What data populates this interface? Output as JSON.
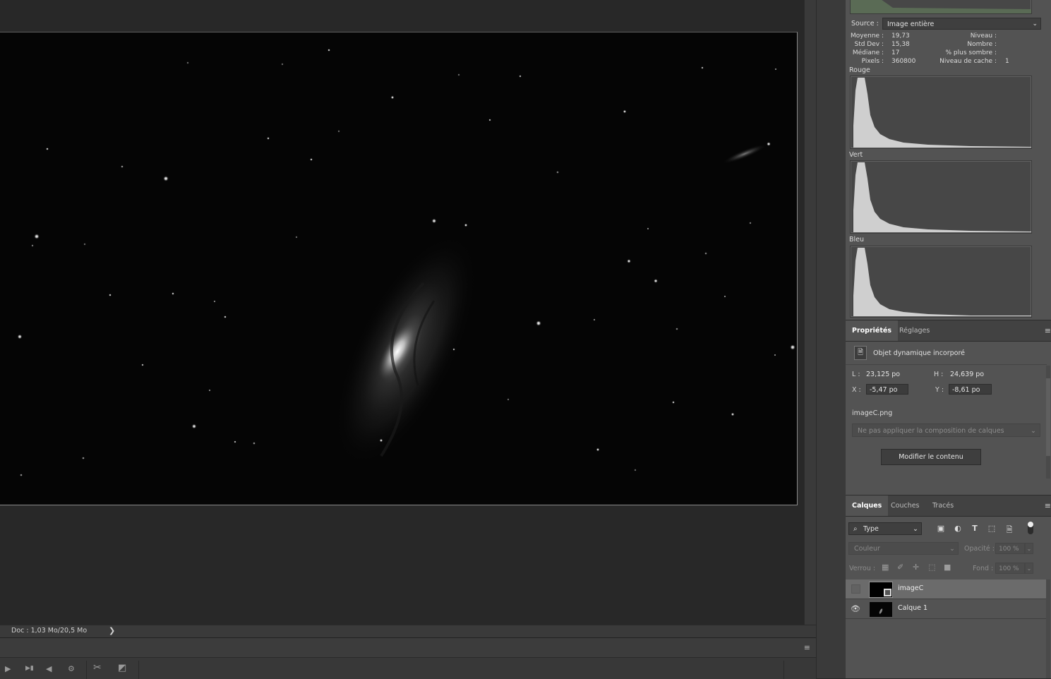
{
  "document": {
    "status_text": "Doc : 1,03 Mo/20,5 Mo",
    "status_arrow": "❯"
  },
  "timeline": {
    "menu_icon": "≡",
    "controls": [
      "▶",
      "▶▮",
      "◀",
      "⚙",
      "✂",
      "◩"
    ]
  },
  "histogram": {
    "source_label": "Source :",
    "source_value": "Image entière",
    "stats_left": [
      {
        "label": "Moyenne :",
        "value": "19,73"
      },
      {
        "label": "Std Dev :",
        "value": "15,38"
      },
      {
        "label": "Médiane :",
        "value": "17"
      },
      {
        "label": "Pixels :",
        "value": "360800"
      }
    ],
    "stats_right": [
      {
        "label": "Niveau :",
        "value": ""
      },
      {
        "label": "Nombre :",
        "value": ""
      },
      {
        "label": "% plus sombre :",
        "value": ""
      },
      {
        "label": "Niveau de cache :",
        "value": "1"
      }
    ],
    "channels": [
      "Rouge",
      "Vert",
      "Bleu"
    ]
  },
  "properties": {
    "tabs": [
      "Propriétés",
      "Réglages"
    ],
    "menu_icon": "≡",
    "type_label": "Objet dynamique incorporé",
    "w_label": "L :",
    "w_value": "23,125 po",
    "h_label": "H :",
    "h_value": "24,639 po",
    "x_label": "X :",
    "x_value": "-5,47 po",
    "y_label": "Y :",
    "y_value": "-8,61 po",
    "file_name": "imageC.png",
    "comp_placeholder": "Ne pas appliquer la composition de calques",
    "edit_button": "Modifier le contenu"
  },
  "layers": {
    "tabs": [
      "Calques",
      "Couches",
      "Tracés"
    ],
    "menu_icon": "≡",
    "filter_label": "Type",
    "blend_mode": "Couleur",
    "opacity_label": "Opacité :",
    "opacity_value": "100 %",
    "lock_label": "Verrou :",
    "fill_label": "Fond :",
    "fill_value": "100 %",
    "items": [
      {
        "name": "imageC",
        "visible": false,
        "selected": true
      },
      {
        "name": "Calque 1",
        "visible": true,
        "selected": false
      }
    ]
  },
  "colors": {
    "panel_bg": "#535353",
    "workspace_bg": "#282828",
    "histogram_fill": "#cfcfcf"
  }
}
